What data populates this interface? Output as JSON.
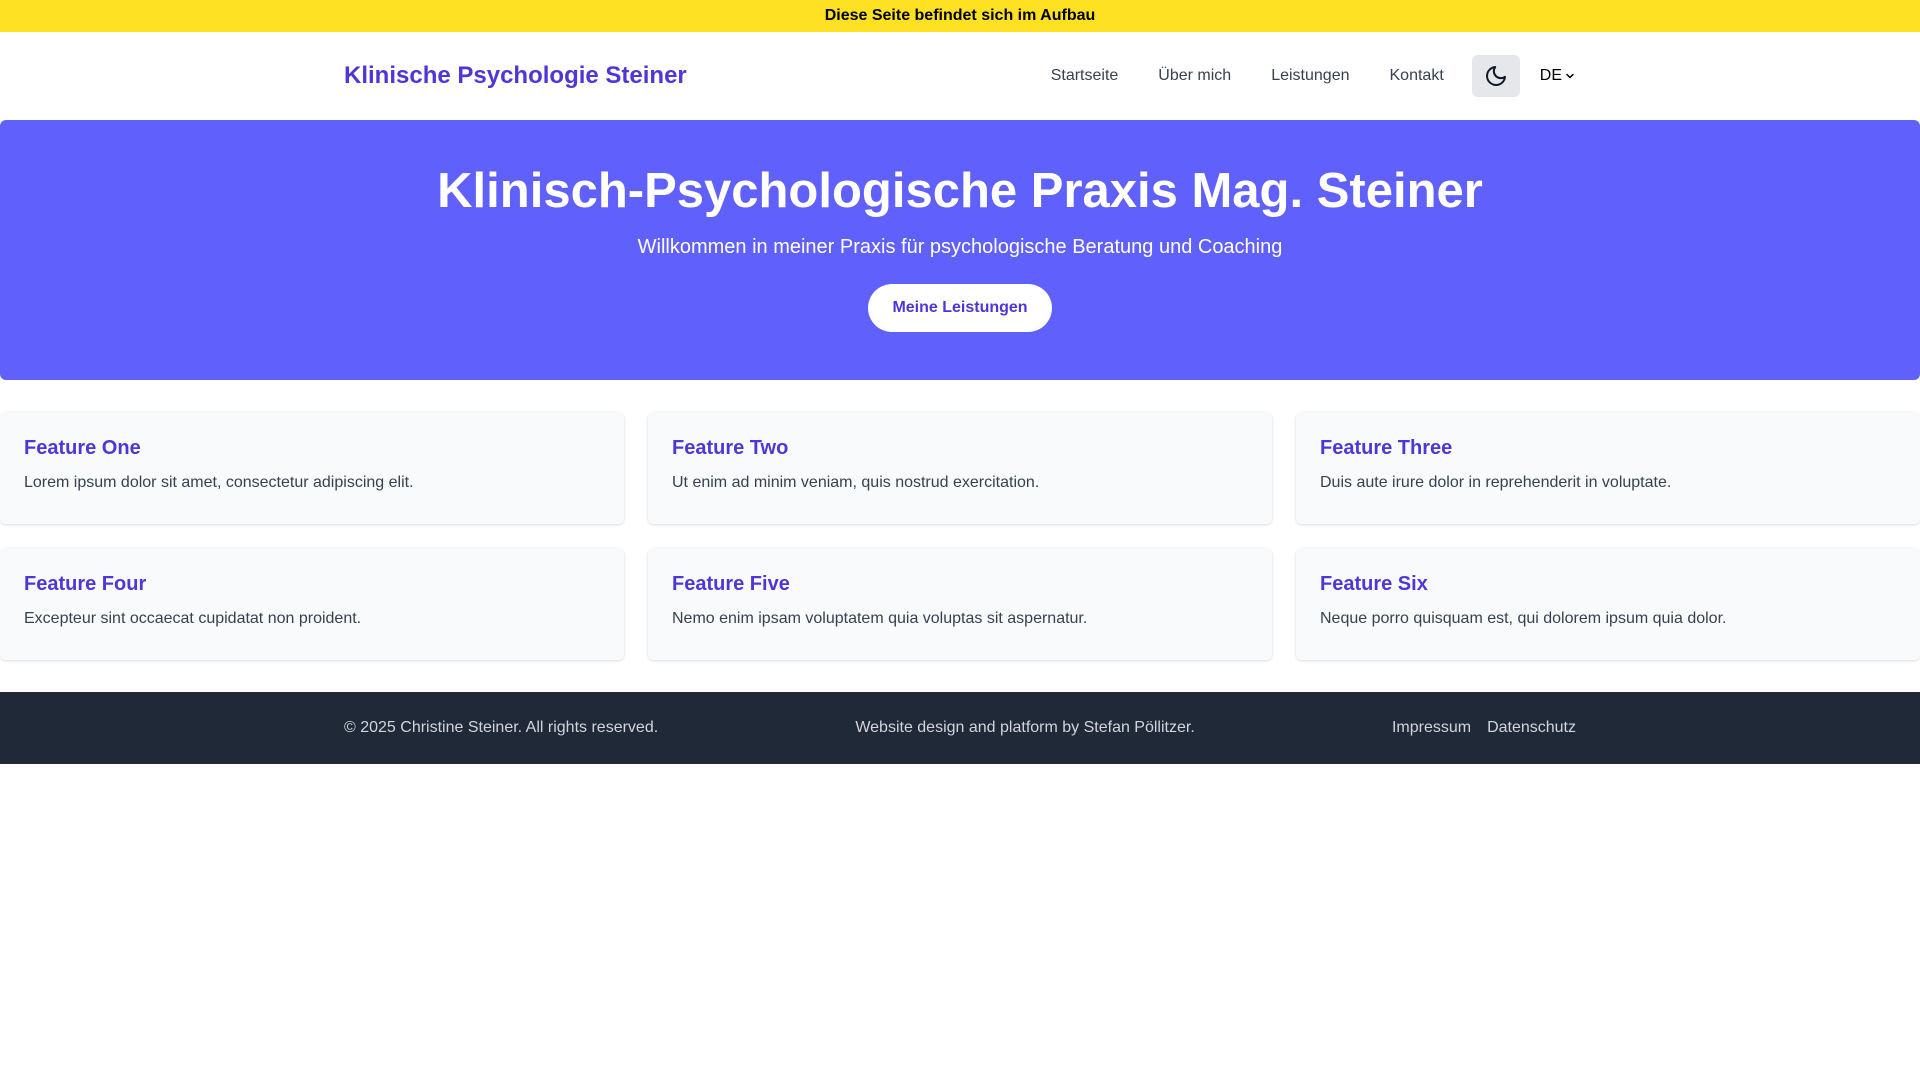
{
  "banner": {
    "text": "Diese Seite befindet sich im Aufbau"
  },
  "header": {
    "brand": "Klinische Psychologie Steiner",
    "nav": [
      "Startseite",
      "Über mich",
      "Leistungen",
      "Kontakt"
    ],
    "theme_icon": "moon-icon",
    "language": "DE"
  },
  "hero": {
    "title": "Klinisch-Psychologische Praxis Mag. Steiner",
    "subtitle": "Willkommen in meiner Praxis für psychologische Beratung und Coaching",
    "button": "Meine Leistungen"
  },
  "features": [
    {
      "title": "Feature One",
      "text": "Lorem ipsum dolor sit amet, consectetur adipiscing elit."
    },
    {
      "title": "Feature Two",
      "text": "Ut enim ad minim veniam, quis nostrud exercitation."
    },
    {
      "title": "Feature Three",
      "text": "Duis aute irure dolor in reprehenderit in voluptate."
    },
    {
      "title": "Feature Four",
      "text": "Excepteur sint occaecat cupidatat non proident."
    },
    {
      "title": "Feature Five",
      "text": "Nemo enim ipsam voluptatem quia voluptas sit aspernatur."
    },
    {
      "title": "Feature Six",
      "text": "Neque porro quisquam est, qui dolorem ipsum quia dolor."
    }
  ],
  "footer": {
    "copyright": "© 2025 Christine Steiner. All rights reserved.",
    "credit": "Website design and platform by Stefan Pöllitzer.",
    "links": [
      "Impressum",
      "Datenschutz"
    ]
  },
  "colors": {
    "banner": "#fde122",
    "accent": "#4f36d6",
    "hero": "#6060fd",
    "footer": "#1f2937"
  }
}
